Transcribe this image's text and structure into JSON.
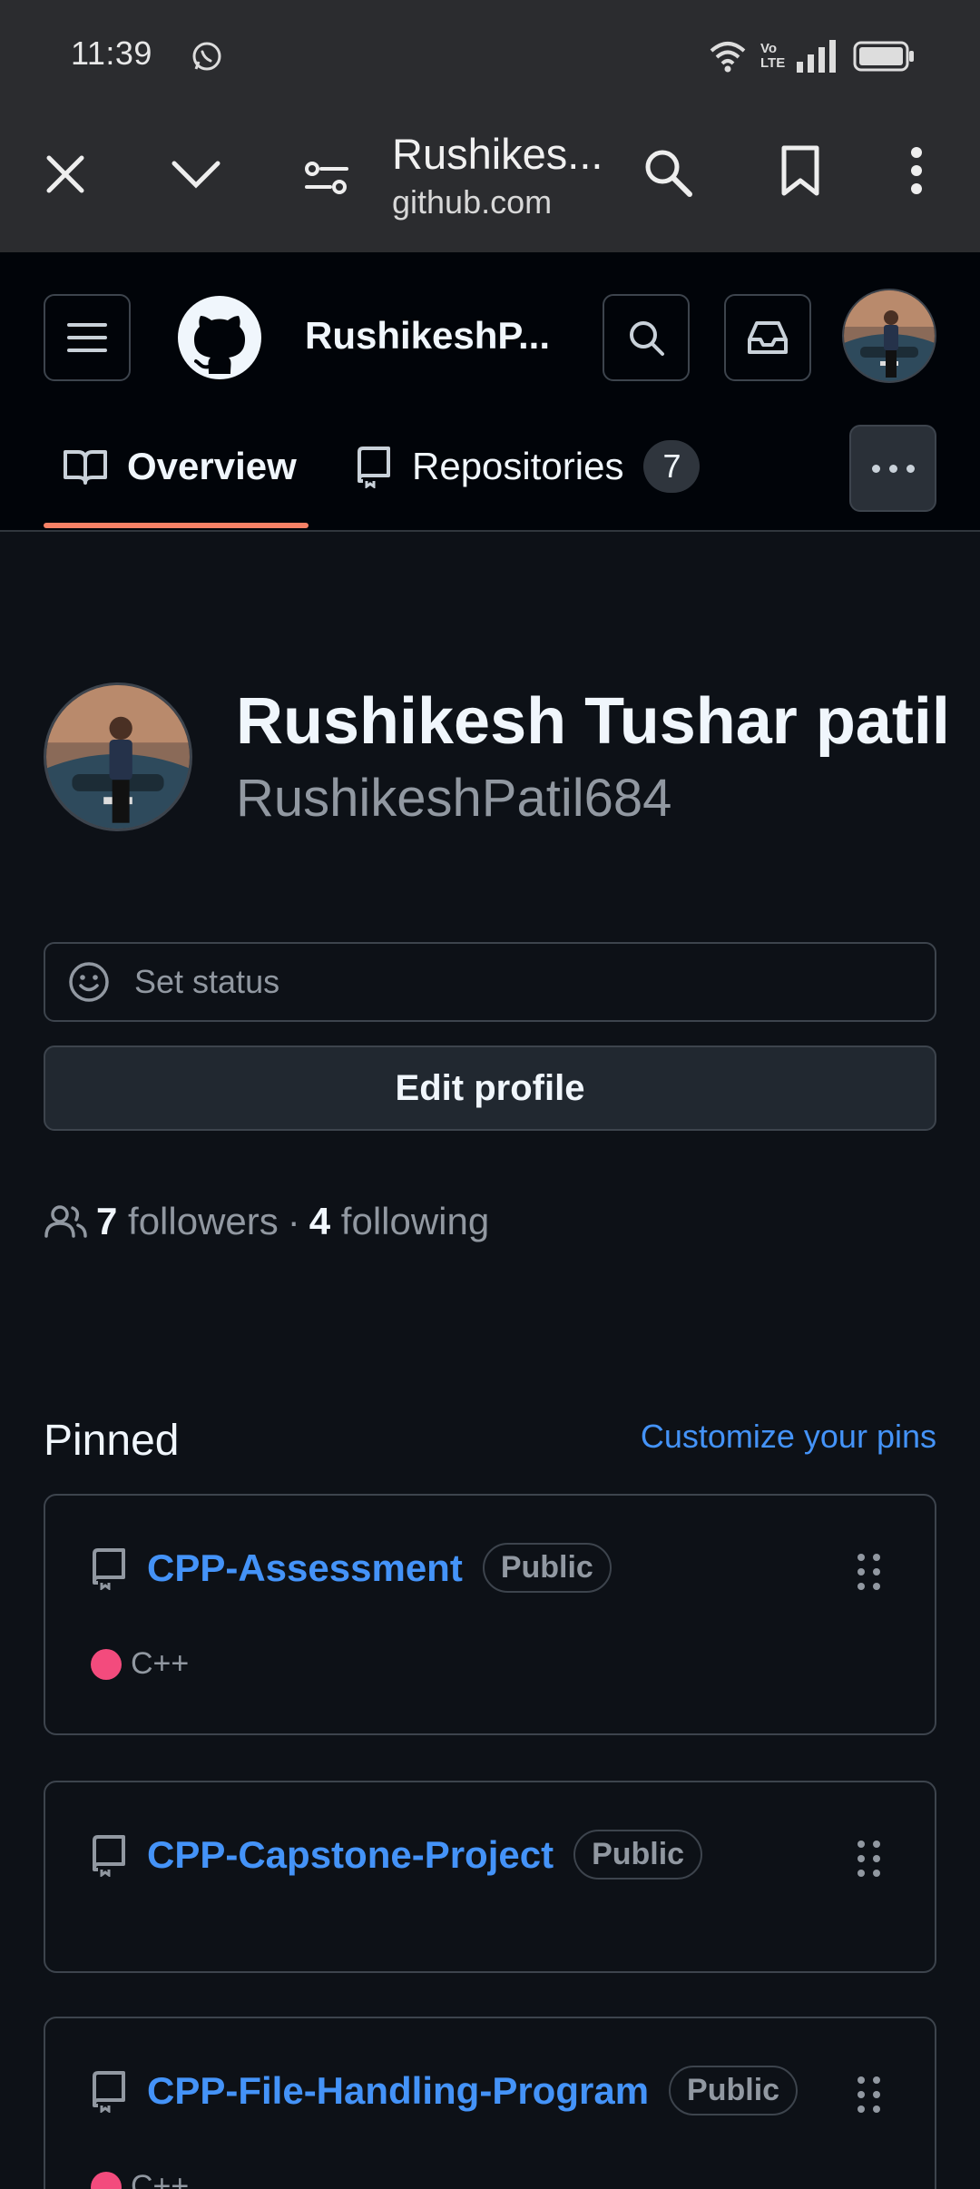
{
  "status_bar": {
    "time": "11:39",
    "network_label": "Vo LTE"
  },
  "browser": {
    "title": "Rushikes...",
    "url": "github.com"
  },
  "header": {
    "username_truncated": "RushikeshP...",
    "tabs": [
      {
        "label": "Overview",
        "selected": true
      },
      {
        "label": "Repositories",
        "count": "7"
      }
    ]
  },
  "profile": {
    "name": "Rushikesh Tushar patil",
    "login": "RushikeshPatil684",
    "set_status": "Set status",
    "edit_profile": "Edit profile",
    "followers_count": "7",
    "followers_label": "followers",
    "separator": "·",
    "following_count": "4",
    "following_label": "following"
  },
  "pinned": {
    "title": "Pinned",
    "customize": "Customize your pins",
    "repos": [
      {
        "name": "CPP-Assessment",
        "visibility": "Public",
        "language": "C++",
        "language_color": "#f34b7d"
      },
      {
        "name": "CPP-Capstone-Project",
        "visibility": "Public"
      },
      {
        "name": "CPP-File-Handling-Program",
        "visibility": "Public",
        "language": "C++",
        "language_color": "#f34b7d"
      }
    ]
  },
  "colors": {
    "accent_link": "#4493f8",
    "tab_underline": "#f78166",
    "background": "#0d1117"
  }
}
